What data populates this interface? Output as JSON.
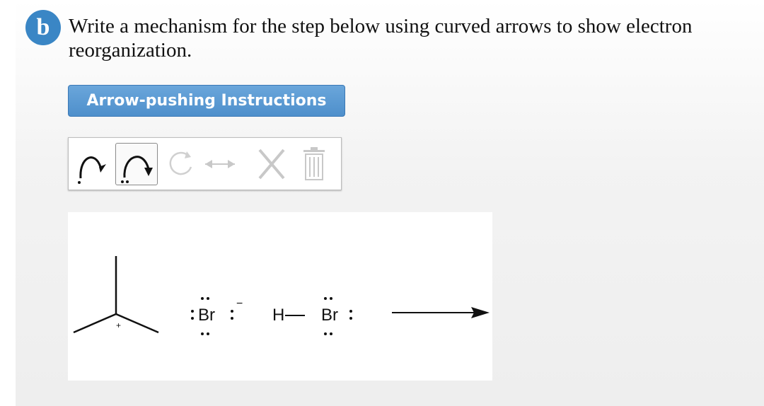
{
  "question": {
    "badge": "b",
    "prompt": "Write a mechanism for the step below using curved arrows to show electron reorganization."
  },
  "instructions_button": {
    "label": "Arrow-pushing Instructions"
  },
  "toolbar": {
    "tools": [
      {
        "name": "single-electron-curved-arrow",
        "enabled": true,
        "selected": false
      },
      {
        "name": "electron-pair-curved-arrow",
        "enabled": true,
        "selected": true
      },
      {
        "name": "rotate-icon",
        "enabled": false
      },
      {
        "name": "resonance-arrow-icon",
        "enabled": false
      },
      {
        "name": "delete-x-icon",
        "enabled": false
      },
      {
        "name": "trash-icon",
        "enabled": false
      }
    ]
  },
  "reaction": {
    "carbocation_charge": "+",
    "bromide_symbol": "Br",
    "bromide_charge": "−",
    "hbr_h": "H",
    "hbr_br": "Br",
    "arrow": "reaction-arrow"
  },
  "colors": {
    "accent": "#3a86c5",
    "button": "#4e8fcb",
    "disabled_tool": "#c8c8c8"
  }
}
